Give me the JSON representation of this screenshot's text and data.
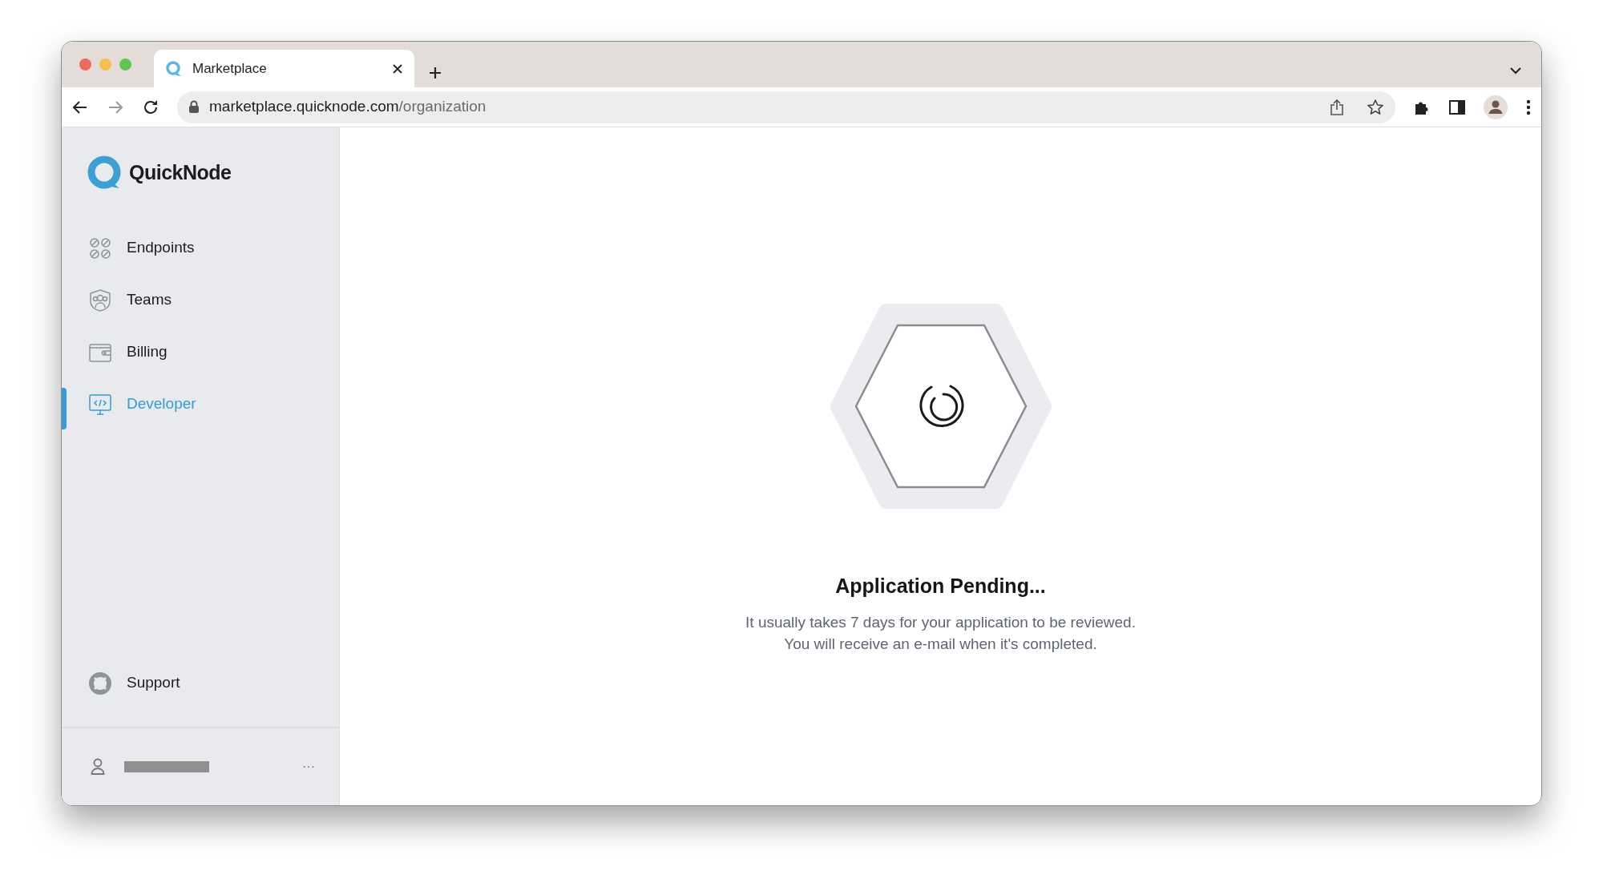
{
  "browser": {
    "tabs": [
      {
        "title": "Marketplace",
        "selected": true
      }
    ],
    "url": {
      "host": "marketplace.quicknode.com",
      "path": "/organization"
    }
  },
  "sidebar": {
    "brand": "QuickNode",
    "items": [
      {
        "label": "Endpoints",
        "selected": false
      },
      {
        "label": "Teams",
        "selected": false
      },
      {
        "label": "Billing",
        "selected": false
      },
      {
        "label": "Developer",
        "selected": true
      }
    ],
    "support": {
      "label": "Support"
    },
    "user": {
      "menu": "···"
    }
  },
  "main": {
    "title": "Application Pending...",
    "message": [
      "It usually takes 7 days for your application to be reviewed.",
      "You will receive an e-mail when it's completed."
    ]
  }
}
